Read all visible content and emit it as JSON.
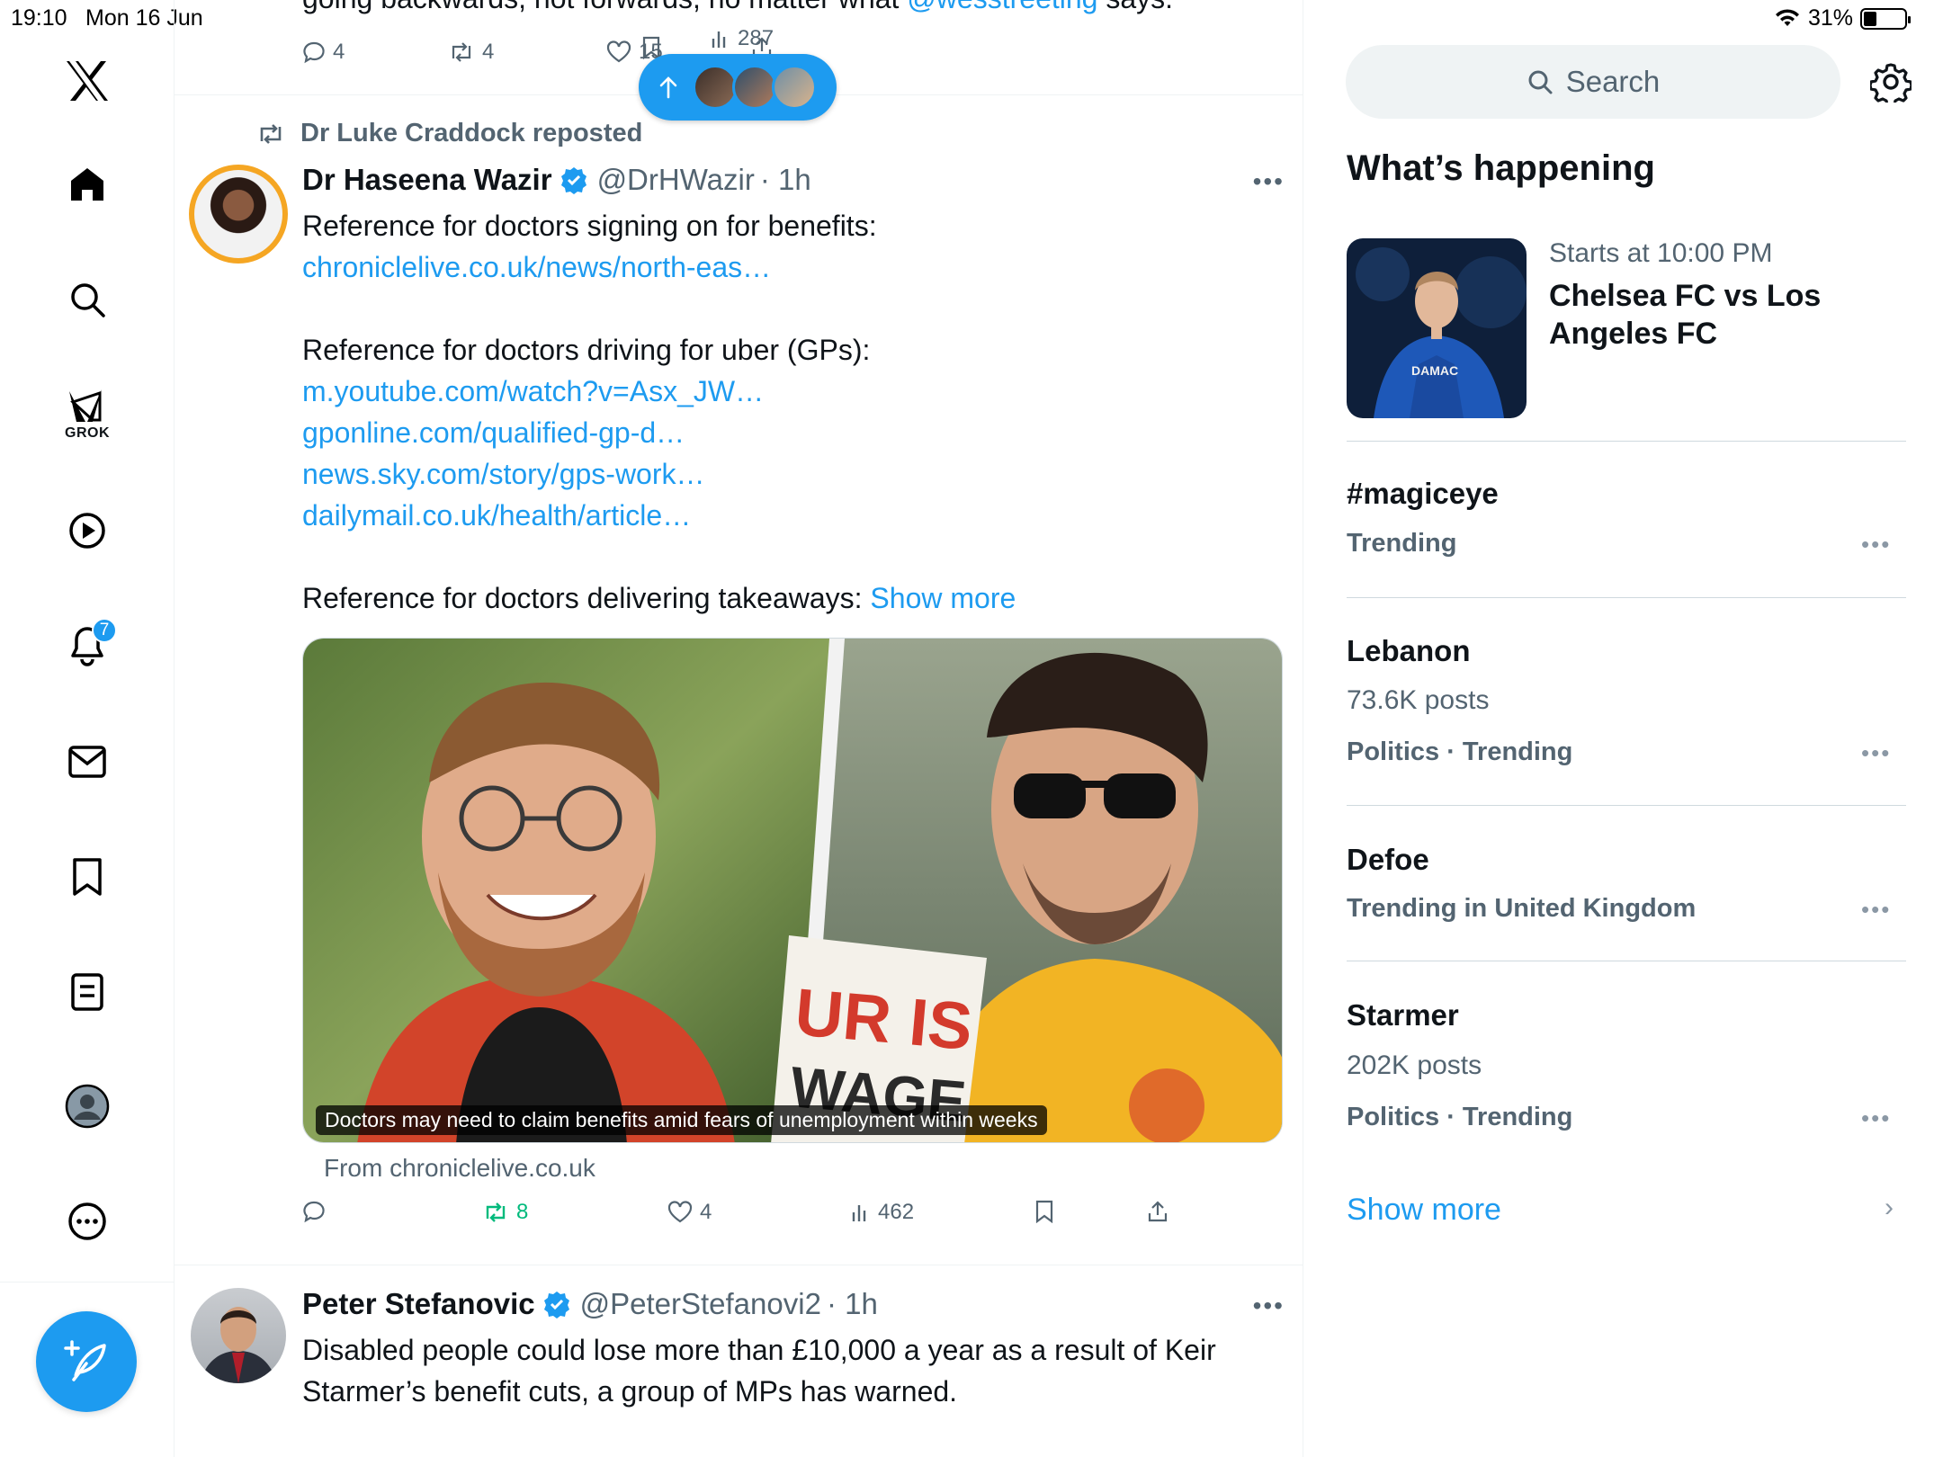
{
  "status_bar": {
    "time": "19:10",
    "date": "Mon 16 Jun",
    "battery": "31%"
  },
  "nav": {
    "notifications_badge": "7",
    "grok_label": "GROK"
  },
  "new_posts_pill": {},
  "prev_tweet": {
    "text_before": "going backwards, not forwards, no matter what ",
    "mention": "@wesstreeting",
    "text_after": " says.",
    "replies": "4",
    "reposts": "4",
    "likes": "15",
    "views": "287"
  },
  "tweet1": {
    "repost_line": "Dr Luke Craddock reposted",
    "name": "Dr Haseena Wazir",
    "handle": "@DrHWazir",
    "time": "· 1h",
    "line1": "Reference for doctors signing on for benefits:",
    "link1": "chroniclelive.co.uk/news/north-eas…",
    "line2": "Reference for doctors driving for uber (GPs):",
    "link2": "m.youtube.com/watch?v=Asx_JW…",
    "link3": "gponline.com/qualified-gp-d…",
    "link4": "news.sky.com/story/gps-work…",
    "link5": "dailymail.co.uk/health/article…",
    "line3": "Reference for doctors delivering takeaways: ",
    "show_more": "Show more",
    "media_caption": "Doctors may need to claim benefits amid fears of unemployment within weeks",
    "media_sign_line1": "UR IS",
    "media_sign_line2": "WAGE",
    "media_source": "From chroniclelive.co.uk",
    "replies": "",
    "reposts": "8",
    "likes": "4",
    "views": "462"
  },
  "tweet2": {
    "name": "Peter Stefanovic",
    "handle": "@PeterStefanovi2",
    "time": "· 1h",
    "text": "Disabled people could lose more than £10,000 a year as a result of Keir Starmer’s benefit cuts, a group of MPs has warned."
  },
  "sidebar": {
    "search_placeholder": "Search",
    "section_title": "What’s happening",
    "event": {
      "meta": "Starts at 10:00 PM",
      "title": "Chelsea FC vs Los Angeles FC",
      "shirt_text": "DAMAC"
    },
    "trends": [
      {
        "name": "#magiceye",
        "posts": "",
        "category": "Trending"
      },
      {
        "name": "Lebanon",
        "posts": "73.6K posts",
        "category": "Politics · Trending"
      },
      {
        "name": "Defoe",
        "posts": "",
        "category": "Trending in United Kingdom"
      },
      {
        "name": "Starmer",
        "posts": "202K posts",
        "category": "Politics · Trending"
      }
    ],
    "show_more": "Show more"
  },
  "colors": {
    "accent": "#1d9bf0",
    "repost_green": "#00ba7c",
    "muted": "#536471"
  }
}
